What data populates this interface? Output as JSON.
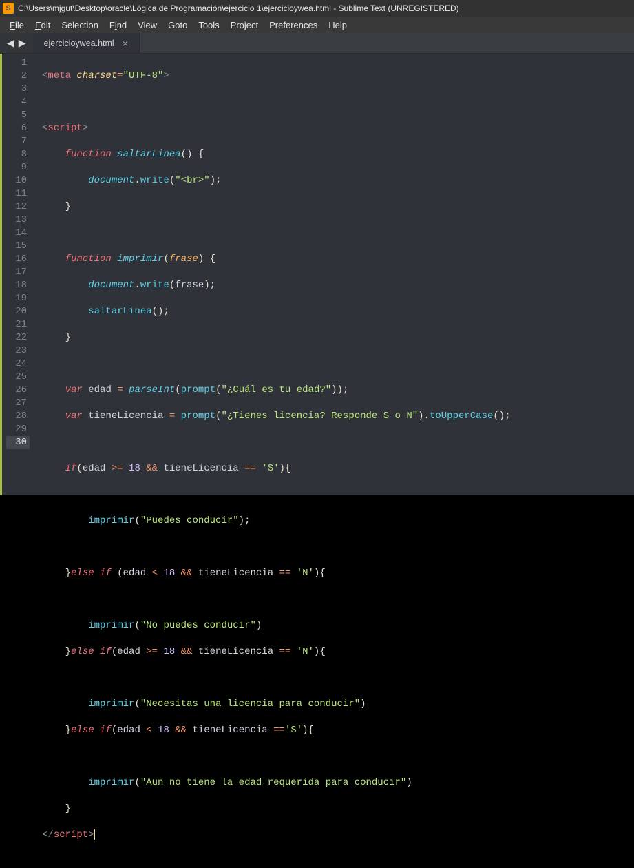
{
  "window": {
    "title": "C:\\Users\\mjgut\\Desktop\\oracle\\Lógica de Programación\\ejercicio 1\\ejercicioywea.html - Sublime Text (UNREGISTERED)"
  },
  "menu": {
    "file": "File",
    "edit": "Edit",
    "selection": "Selection",
    "find": "Find",
    "view": "View",
    "goto": "Goto",
    "tools": "Tools",
    "project": "Project",
    "preferences": "Preferences",
    "help": "Help"
  },
  "tab": {
    "name": "ejercicioywea.html",
    "close": "×"
  },
  "nav": {
    "prev": "◀",
    "next": "▶"
  },
  "lines": [
    "1",
    "2",
    "3",
    "4",
    "5",
    "6",
    "7",
    "8",
    "9",
    "10",
    "11",
    "12",
    "13",
    "14",
    "15",
    "16",
    "17",
    "18",
    "19",
    "20",
    "21",
    "22",
    "23",
    "24",
    "25",
    "26",
    "27",
    "28",
    "29",
    "30"
  ],
  "code": {
    "l1": {
      "a": "<",
      "b": "meta",
      "sp": " ",
      "c": "charset",
      "d": "=",
      "e": "\"UTF-8\"",
      "f": ">"
    },
    "l3": {
      "a": "<",
      "b": "script",
      "c": ">"
    },
    "l4": {
      "a": "function",
      "sp": " ",
      "b": "saltarLinea",
      "c": "() {"
    },
    "l5": {
      "a": "document",
      "b": ".",
      "c": "write",
      "d": "(",
      "e": "\"<br>\"",
      "f": ");"
    },
    "l6": {
      "a": "}"
    },
    "l8": {
      "a": "function",
      "sp": " ",
      "b": "imprimir",
      "c": "(",
      "d": "frase",
      "e": ") {"
    },
    "l9": {
      "a": "document",
      "b": ".",
      "c": "write",
      "d": "(",
      "e": "frase",
      "f": ");"
    },
    "l10": {
      "a": "saltarLinea",
      "b": "();"
    },
    "l11": {
      "a": "}"
    },
    "l13": {
      "a": "var",
      "sp": " ",
      "b": "edad",
      "c": " = ",
      "d": "parseInt",
      "e": "(",
      "f": "prompt",
      "g": "(",
      "h": "\"¿Cuál es tu edad?\"",
      "i": "));"
    },
    "l14": {
      "a": "var",
      "sp": " ",
      "b": "tieneLicencia",
      "c": " = ",
      "d": "prompt",
      "e": "(",
      "f": "\"¿Tienes licencia? Responde S o N\"",
      "g": ").",
      "h": "toUpperCase",
      "i": "();"
    },
    "l16": {
      "a": "if",
      "b": "(",
      "c": "edad",
      "d": " >= ",
      "e": "18",
      "f": " && ",
      "g": "tieneLicencia",
      "h": " == ",
      "i": "'S'",
      "j": "){"
    },
    "l18": {
      "a": "imprimir",
      "b": "(",
      "c": "\"Puedes conducir\"",
      "d": ");"
    },
    "l20": {
      "a": "}",
      "b": "else if",
      "sp": " ",
      "c": "(",
      "d": "edad",
      "e": " < ",
      "f": "18",
      "g": " && ",
      "h": "tieneLicencia",
      "i": " == ",
      "j": "'N'",
      "k": "){"
    },
    "l22": {
      "a": "imprimir",
      "b": "(",
      "c": "\"No puedes conducir\"",
      "d": ")"
    },
    "l23": {
      "a": "}",
      "b": "else if",
      "c": "(",
      "d": "edad",
      "e": " >= ",
      "f": "18",
      "g": " && ",
      "h": "tieneLicencia",
      "i": " == ",
      "j": "'N'",
      "k": "){"
    },
    "l25": {
      "a": "imprimir",
      "b": "(",
      "c": "\"Necesitas una licencia para conducir\"",
      "d": ")"
    },
    "l26": {
      "a": "}",
      "b": "else if",
      "c": "(",
      "d": "edad",
      "e": " < ",
      "f": "18",
      "g": " && ",
      "h": "tieneLicencia",
      "i": " ==",
      "j": "'S'",
      "k": "){"
    },
    "l28": {
      "a": "imprimir",
      "b": "(",
      "c": "\"Aun no tiene la edad requerida para conducir\"",
      "d": ")"
    },
    "l29": {
      "a": "}"
    },
    "l30": {
      "a": "</",
      "b": "script",
      "c": ">"
    }
  }
}
